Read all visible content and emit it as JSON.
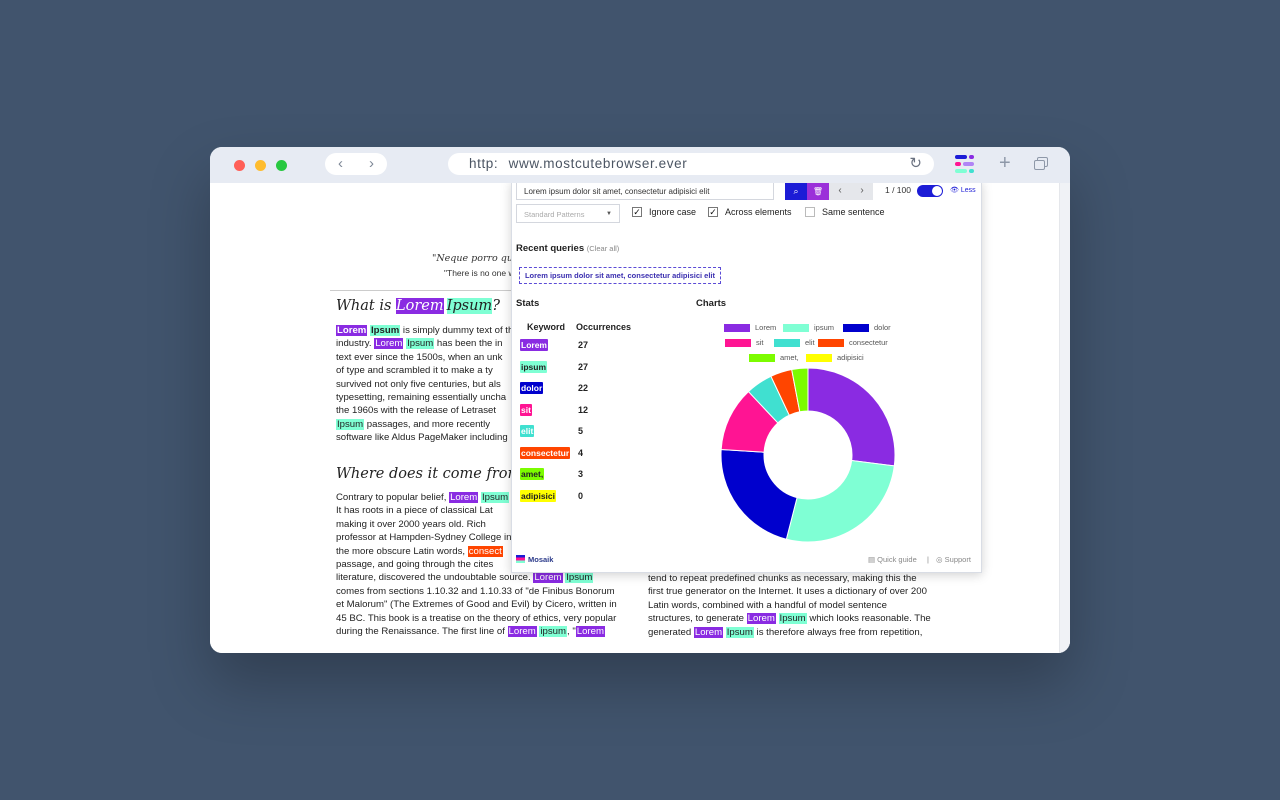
{
  "browser": {
    "url_scheme": "http:",
    "url": "www.mostcutebrowser.ever",
    "nav_back": "‹",
    "nav_forward": "›",
    "reload_icon": "↻",
    "new_tab": "+"
  },
  "page": {
    "quote_line1": "\"Neque porro quis",
    "quote_line2": "\"There is no one w",
    "heading1_prefix": "What is",
    "heading1_lorem": "Lorem",
    "heading1_ipsum": "Ipsum",
    "heading1_suffix": "?",
    "heading2": "Where does it come from?",
    "para1": [
      {
        "pre": "",
        "hl1": "Lorem",
        "mid": " ",
        "hl2": "Ipsum",
        "post": " is simply dummy text of th"
      },
      {
        "pre": "industry. ",
        "hl1": "Lorem",
        "mid": " ",
        "hl2": "Ipsum",
        "post": " has been the in"
      },
      {
        "pre": "text ever since the 1500s, when an unk",
        "hl1": "",
        "mid": "",
        "hl2": "",
        "post": ""
      },
      {
        "pre": "of type and scrambled it to make a ty",
        "hl1": "",
        "mid": "",
        "hl2": "",
        "post": ""
      },
      {
        "pre": "survived not only five centuries, but als",
        "hl1": "",
        "mid": "",
        "hl2": "",
        "post": ""
      },
      {
        "pre": "typesetting, remaining essentially uncha",
        "hl1": "",
        "mid": "",
        "hl2": "",
        "post": ""
      },
      {
        "pre": "the 1960s with the release of Letraset",
        "hl1": "",
        "mid": "",
        "hl2": "",
        "post": ""
      },
      {
        "pre": "",
        "hl1": "",
        "mid": "",
        "hl2": "Ipsum",
        "post": " passages, and more recently"
      },
      {
        "pre": "software like Aldus PageMaker including",
        "hl1": "",
        "mid": "",
        "hl2": "",
        "post": ""
      }
    ],
    "para2": [
      {
        "pre": "Contrary to popular belief, ",
        "hl1": "Lorem",
        "mid": " ",
        "hl2": "Ipsum",
        "post": ""
      },
      {
        "pre": "It has roots in a piece of classical Lat",
        "hl1": "",
        "mid": "",
        "hl2": "",
        "post": ""
      },
      {
        "pre": "making it over 2000 years old. Rich",
        "hl1": "",
        "mid": "",
        "hl2": "",
        "post": ""
      },
      {
        "pre": "professor at Hampden-Sydney College in",
        "hl1": "",
        "mid": "",
        "hl2": "",
        "post": ""
      },
      {
        "pre": "the more obscure Latin words, ",
        "hl1": "",
        "mid": "",
        "hl2": "",
        "post": "",
        "orange": "consect"
      },
      {
        "pre": "passage, and going through the cites",
        "hl1": "",
        "mid": "",
        "hl2": "",
        "post": ""
      },
      {
        "pre": "literature, discovered the undoubtable source. ",
        "hl1": "Lorem",
        "mid": " ",
        "hl2": "Ipsum",
        "post": ""
      },
      {
        "pre": "comes from sections 1.10.32 and 1.10.33 of \"de Finibus Bonorum",
        "hl1": "",
        "mid": "",
        "hl2": "",
        "post": ""
      },
      {
        "pre": "et Malorum\" (The Extremes of Good and Evil) by Cicero, written in",
        "hl1": "",
        "mid": "",
        "hl2": "",
        "post": ""
      },
      {
        "pre": "45 BC. This book is a treatise on the theory of ethics, very popular",
        "hl1": "",
        "mid": "",
        "hl2": "",
        "post": ""
      },
      {
        "pre": "during the Renaissance. The first line of ",
        "hl1": "Lorem",
        "mid": " ",
        "hl2": "ipsum",
        "post": ", \"",
        "hl3": "Lorem"
      }
    ],
    "para3": [
      {
        "pre": "tend to repeat predefined chunks as necessary, making this the",
        "hl1": "",
        "mid": "",
        "hl2": "",
        "post": ""
      },
      {
        "pre": "first true generator on the Internet. It uses a dictionary of over 200",
        "hl1": "",
        "mid": "",
        "hl2": "",
        "post": ""
      },
      {
        "pre": "Latin words, combined with a handful of model sentence",
        "hl1": "",
        "mid": "",
        "hl2": "",
        "post": ""
      },
      {
        "pre": "structures, to generate ",
        "hl1": "Lorem",
        "mid": " ",
        "hl2": "Ipsum",
        "post": " which looks reasonable. The"
      },
      {
        "pre": "generated ",
        "hl1": "Lorem",
        "mid": " ",
        "hl2": "Ipsum",
        "post": " is therefore always free from repetition,"
      }
    ]
  },
  "panel": {
    "search_value": "Lorem ipsum dolor sit amet, consectetur adipisici elit",
    "search_icon": "⌕",
    "trash_icon": "🗑",
    "prev_icon": "‹",
    "next_icon": "›",
    "counter": "1 / 100",
    "less_label": "👁 Less",
    "pattern_placeholder": "Standard Patterns",
    "ignore_case": "Ignore case",
    "across_elements": "Across elements",
    "same_sentence": "Same sentence",
    "recent_title": "Recent queries",
    "clear_all": "(Clear all)",
    "recent_query": "Lorem ipsum dolor sit amet, consectetur adipisici elit",
    "stats_title": "Stats",
    "charts_title": "Charts",
    "keyword_header": "Keyword",
    "occurrences_header": "Occurrences",
    "brand": "Mosaik",
    "quick_guide": "Quick guide",
    "support": "Support",
    "separator": "|"
  },
  "chart_data": {
    "type": "pie",
    "categories": [
      "Lorem",
      "ipsum",
      "dolor",
      "sit",
      "elit",
      "consectetur",
      "amet,",
      "adipisici"
    ],
    "values": [
      27,
      27,
      22,
      12,
      5,
      4,
      3,
      0
    ],
    "colors": [
      "#8a2be2",
      "#7fffd4",
      "#0000cd",
      "#ff1493",
      "#40e0d0",
      "#ff4500",
      "#7cfc00",
      "#ffff00"
    ],
    "title": "",
    "legend": "top"
  },
  "stats": [
    {
      "keyword": "Lorem",
      "occurrences": "27",
      "bg": "#8a2be2",
      "fg": "#ffffff"
    },
    {
      "keyword": "ipsum",
      "occurrences": "27",
      "bg": "#7fffd4",
      "fg": "#222222"
    },
    {
      "keyword": "dolor",
      "occurrences": "22",
      "bg": "#0000cd",
      "fg": "#ffffff"
    },
    {
      "keyword": "sit",
      "occurrences": "12",
      "bg": "#ff1493",
      "fg": "#ffffff"
    },
    {
      "keyword": "elit",
      "occurrences": "5",
      "bg": "#40e0d0",
      "fg": "#ffffff"
    },
    {
      "keyword": "consectetur",
      "occurrences": "4",
      "bg": "#ff4500",
      "fg": "#ffffff"
    },
    {
      "keyword": "amet,",
      "occurrences": "3",
      "bg": "#7cfc00",
      "fg": "#222222"
    },
    {
      "keyword": "adipisici",
      "occurrences": "0",
      "bg": "#ffff00",
      "fg": "#222222"
    }
  ]
}
